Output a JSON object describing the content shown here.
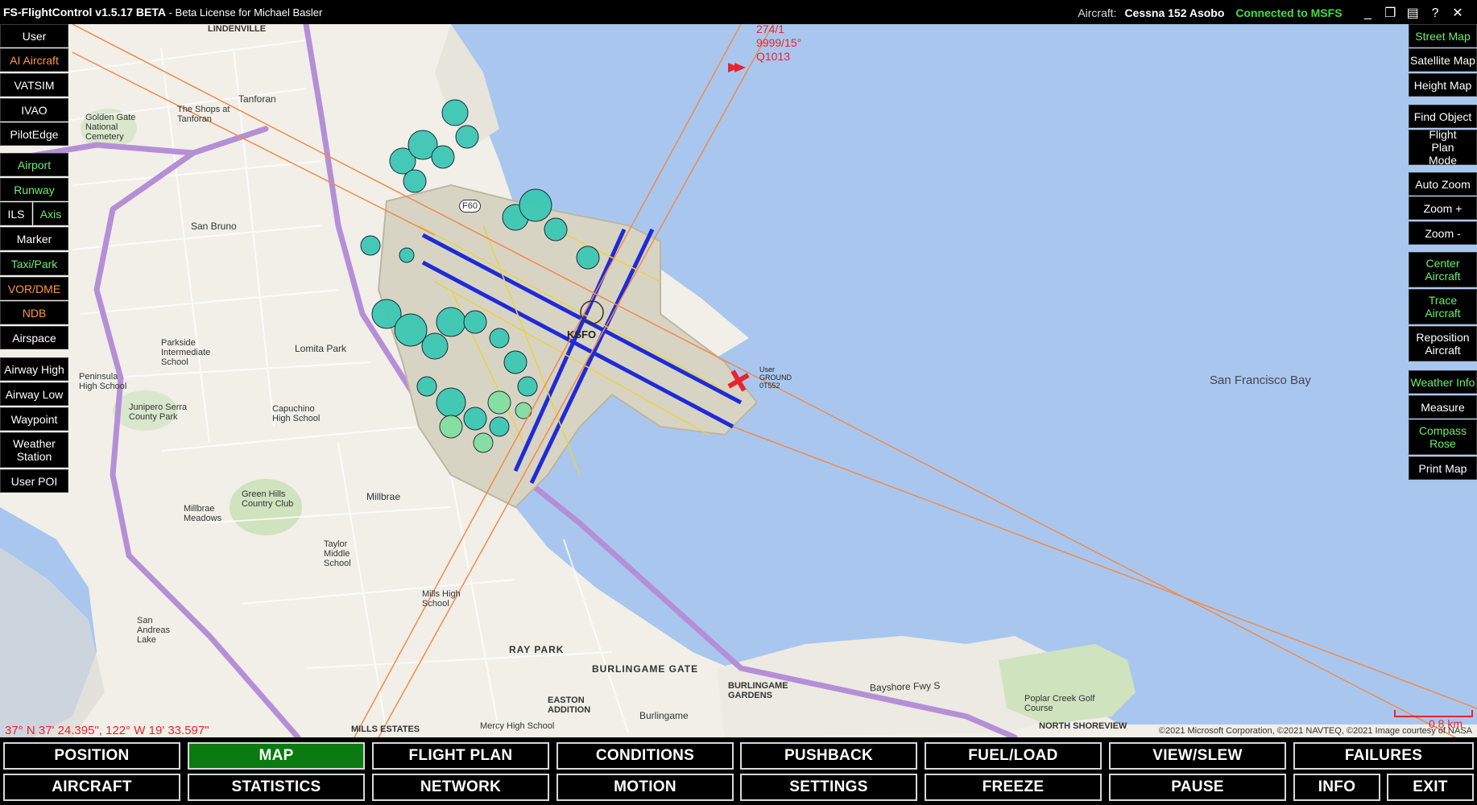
{
  "titlebar": {
    "app_name": "FS-FlightControl v1.5.17 BETA",
    "license": " - Beta License for Michael Basler",
    "aircraft_label": "Aircraft:",
    "aircraft_name": "Cessna 152 Asobo",
    "connection_status": "Connected to MSFS"
  },
  "left_panel": [
    {
      "label": "User",
      "color": "white"
    },
    {
      "label": "AI Aircraft",
      "color": "orange"
    },
    {
      "label": "VATSIM",
      "color": "white"
    },
    {
      "label": "IVAO",
      "color": "white"
    },
    {
      "label": "PilotEdge",
      "color": "white"
    },
    {
      "label": "Airport",
      "color": "green"
    },
    {
      "label": "Runway",
      "color": "green"
    },
    {
      "label": "ILS",
      "color": "white"
    },
    {
      "label": "Axis",
      "color": "green"
    },
    {
      "label": "Marker",
      "color": "white"
    },
    {
      "label": "Taxi/Park",
      "color": "green"
    },
    {
      "label": "VOR/DME",
      "color": "orange"
    },
    {
      "label": "NDB",
      "color": "orange"
    },
    {
      "label": "Airspace",
      "color": "white"
    },
    {
      "label": "Airway High",
      "color": "white"
    },
    {
      "label": "Airway Low",
      "color": "white"
    },
    {
      "label": "Waypoint",
      "color": "white"
    },
    {
      "label": "Weather Station",
      "color": "white"
    },
    {
      "label": "User POI",
      "color": "white"
    }
  ],
  "right_panel": [
    {
      "label": "Street Map",
      "color": "green"
    },
    {
      "label": "Satellite Map",
      "color": "white"
    },
    {
      "label": "Height Map",
      "color": "white"
    },
    {
      "label": "Find Object",
      "color": "white"
    },
    {
      "label": "Flight Plan Mode",
      "color": "white"
    },
    {
      "label": "Auto Zoom",
      "color": "white"
    },
    {
      "label": "Zoom +",
      "color": "white"
    },
    {
      "label": "Zoom -",
      "color": "white"
    },
    {
      "label": "Center Aircraft",
      "color": "green"
    },
    {
      "label": "Trace Aircraft",
      "color": "green"
    },
    {
      "label": "Reposition Aircraft",
      "color": "white"
    },
    {
      "label": "Weather Info",
      "color": "green"
    },
    {
      "label": "Measure",
      "color": "white"
    },
    {
      "label": "Compass Rose",
      "color": "green"
    },
    {
      "label": "Print Map",
      "color": "white"
    }
  ],
  "bottom_tabs_row1": [
    "POSITION",
    "MAP",
    "FLIGHT PLAN",
    "CONDITIONS",
    "PUSHBACK",
    "FUEL/LOAD",
    "VIEW/SLEW",
    "FAILURES"
  ],
  "bottom_tabs_row2": [
    "AIRCRAFT",
    "STATISTICS",
    "NETWORK",
    "MOTION",
    "SETTINGS",
    "FREEZE",
    "PAUSE",
    "INFO",
    "EXIT"
  ],
  "active_tab": "MAP",
  "map": {
    "coordinates": "37° N 37' 24.395\", 122° W 19' 33.597\"",
    "copyright": "©2021 Microsoft Corporation, ©2021 NAVTEQ, ©2021 Image courtesy of NASA",
    "scale": "0.8 km",
    "airport_code": "KSFO",
    "weather_lines": [
      "274/1",
      "9999/15°",
      "Q1013"
    ],
    "user_tag": [
      "User",
      "GROUND",
      "0T552"
    ],
    "label_F60": "F60",
    "labels": [
      "LINDENVILLE",
      "Tanforan",
      "The Shops at Tanforan",
      "Golden Gate National Cemetery",
      "San Bruno",
      "Lomita Park",
      "Parkside Intermediate School",
      "Peninsula High School",
      "Junipero Serra County Park",
      "Capuchino High School",
      "Green Hills Country Club",
      "Millbrae",
      "Millbrae Meadows",
      "Taylor Middle School",
      "San Andreas Lake",
      "Mills High School",
      "RAY PARK",
      "BURLINGAME GATE",
      "EASTON ADDITION",
      "Burlingame",
      "BURLINGAME GARDENS",
      "Poplar Creek Golf Course",
      "NORTH SHOREVIEW",
      "MILLS ESTATES",
      "San Francisco Bay",
      "Bayshore Fwy S",
      "Mercy High School"
    ],
    "colors": {
      "water": "#a9c7ee",
      "land": "#f1efe8",
      "freeway": "#b58fd6",
      "runway": "#1f2bd6",
      "radial": "#f08a4e",
      "tree": "#3cc8b4"
    }
  }
}
